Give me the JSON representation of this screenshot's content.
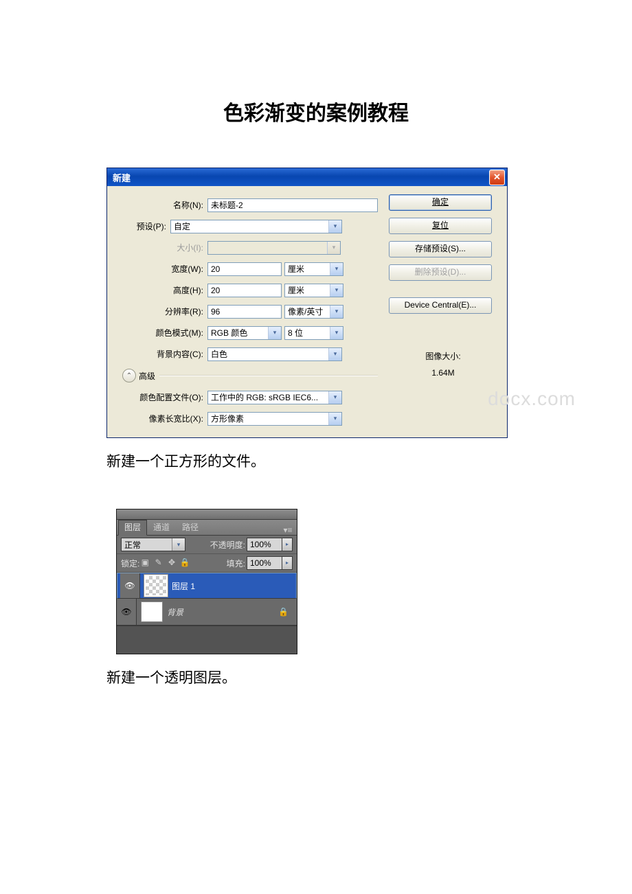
{
  "page": {
    "title": "色彩渐变的案例教程",
    "caption1": "新建一个正方形的文件。",
    "caption2": "新建一个透明图层。"
  },
  "dialog": {
    "title": "新建",
    "labels": {
      "name": "名称(N):",
      "preset": "预设(P):",
      "size": "大小(I):",
      "width": "宽度(W):",
      "height": "高度(H):",
      "resolution": "分辨率(R):",
      "color_mode": "颜色模式(M):",
      "bg": "背景内容(C):",
      "advanced": "高级",
      "profile": "颜色配置文件(O):",
      "aspect": "像素长宽比(X):",
      "img_size_label": "图像大小:",
      "img_size_value": "1.64M"
    },
    "values": {
      "name": "未标题-2",
      "preset": "自定",
      "size": "",
      "width": "20",
      "width_unit": "厘米",
      "height": "20",
      "height_unit": "厘米",
      "resolution": "96",
      "resolution_unit": "像素/英寸",
      "color_mode": "RGB 颜色",
      "bit_depth": "8 位",
      "bg": "白色",
      "profile": "工作中的 RGB: sRGB IEC6...",
      "aspect": "方形像素"
    },
    "buttons": {
      "ok": "确定",
      "reset": "复位",
      "save_preset": "存储预设(S)...",
      "delete_preset": "删除预设(D)...",
      "device_central": "Device Central(E)..."
    }
  },
  "watermark": "docx.com",
  "layers": {
    "tabs": {
      "layers": "图层",
      "channels": "通道",
      "paths": "路径"
    },
    "blend_mode": "正常",
    "opacity_label": "不透明度:",
    "opacity_value": "100%",
    "lock_label": "锁定:",
    "fill_label": "填充:",
    "fill_value": "100%",
    "layer1": "图层 1",
    "bg": "背景"
  }
}
